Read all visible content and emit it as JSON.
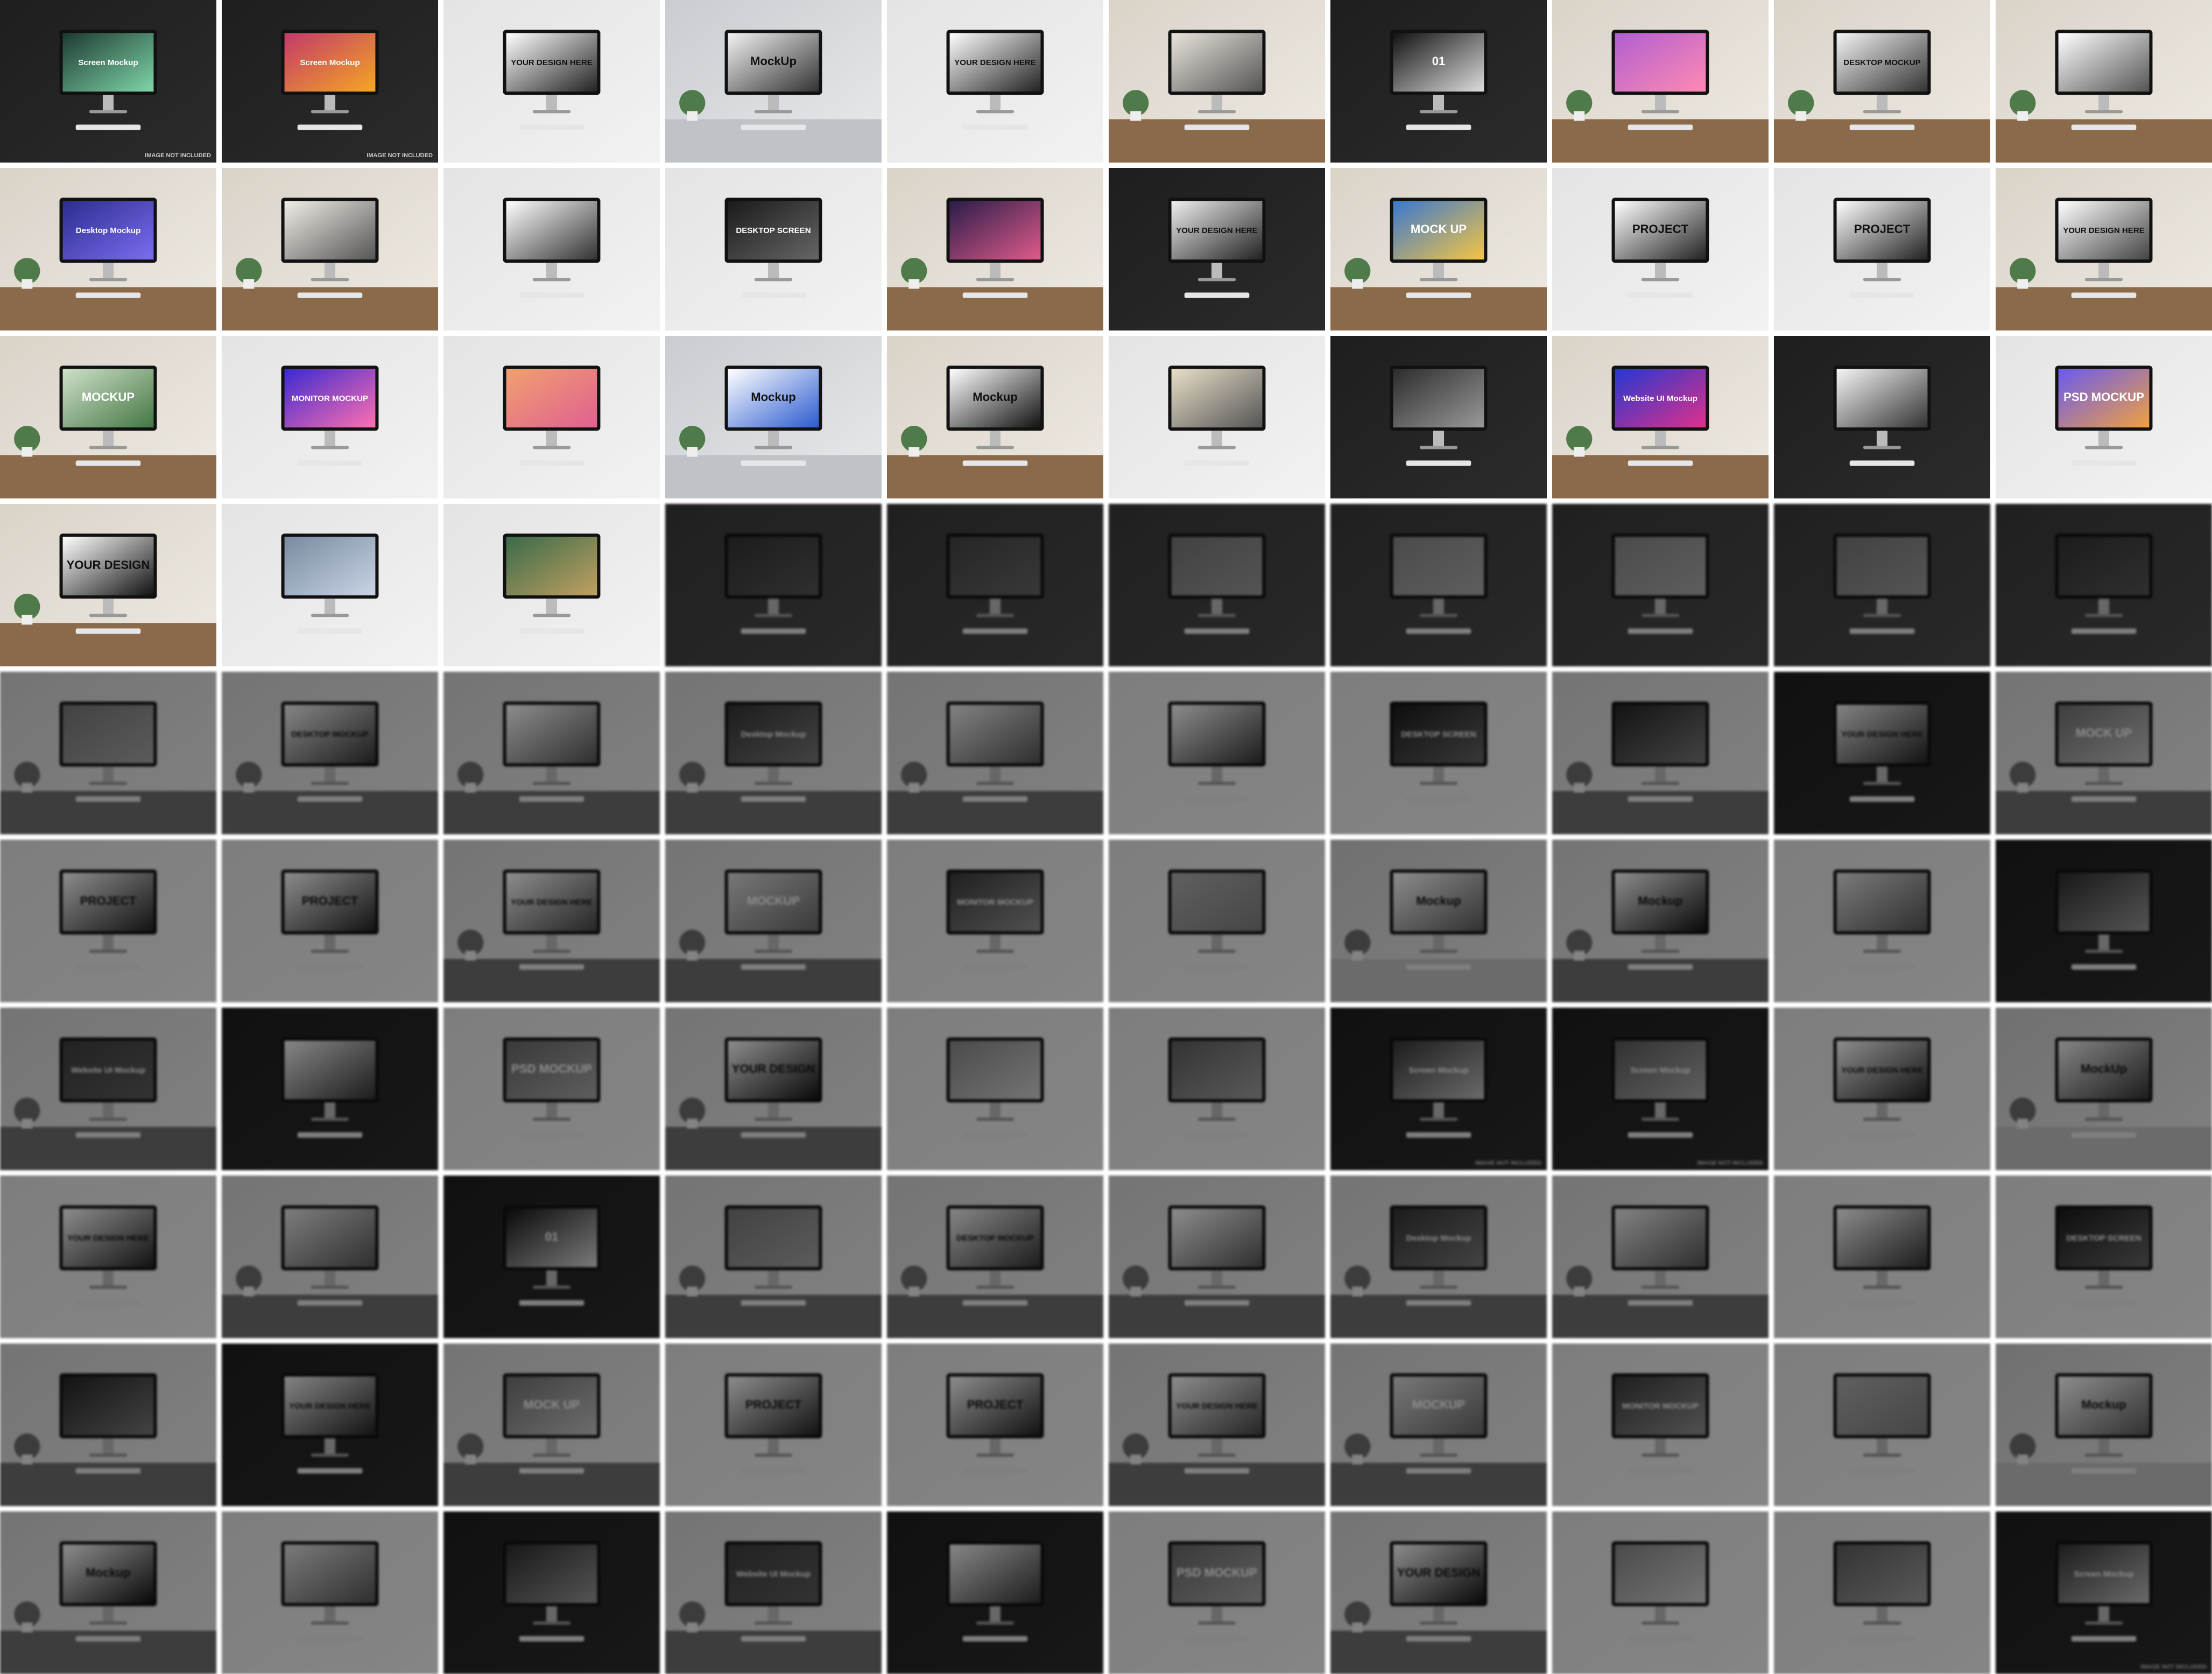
{
  "gallery": {
    "columns": 10,
    "rows": 10,
    "tiles": [
      {
        "style": "dark",
        "screen": "#1d3a32",
        "accent": "#7fd6a8",
        "text": "Screen Mockup",
        "caption": "IMAGE NOT INCLUDED"
      },
      {
        "style": "dark",
        "screen": "#c23a6a",
        "accent": "#f5a623",
        "text": "Screen Mockup",
        "caption": "IMAGE NOT INCLUDED"
      },
      {
        "style": "light",
        "screen": "#ffffff",
        "accent": "#222222",
        "text": "YOUR DESIGN HERE",
        "caption": ""
      },
      {
        "style": "photo",
        "screen": "#f2f2f2",
        "accent": "#333333",
        "text": "MockUp",
        "caption": ""
      },
      {
        "style": "light",
        "screen": "#ffffff",
        "accent": "#222222",
        "text": "YOUR DESIGN HERE",
        "caption": ""
      },
      {
        "style": "desk",
        "screen": "#e9e4dc",
        "accent": "#555555",
        "text": "",
        "caption": ""
      },
      {
        "style": "dark",
        "screen": "#111111",
        "accent": "#dddddd",
        "text": "01",
        "caption": ""
      },
      {
        "style": "desk",
        "screen": "#b05fd0",
        "accent": "#ff8ab3",
        "text": "",
        "caption": ""
      },
      {
        "style": "desk",
        "screen": "#f4f4f4",
        "accent": "#333333",
        "text": "DESKTOP MOCKUP",
        "caption": ""
      },
      {
        "style": "desk",
        "screen": "#ffffff",
        "accent": "#555555",
        "text": "",
        "caption": ""
      },
      {
        "style": "desk",
        "screen": "#2c2d8f",
        "accent": "#7b6df0",
        "text": "Desktop Mockup",
        "caption": ""
      },
      {
        "style": "desk",
        "screen": "#f1ede6",
        "accent": "#555555",
        "text": "",
        "caption": ""
      },
      {
        "style": "light",
        "screen": "#ffffff",
        "accent": "#333333",
        "text": "",
        "caption": ""
      },
      {
        "style": "light",
        "screen": "#1a1a1a",
        "accent": "#666666",
        "text": "DESKTOP SCREEN",
        "caption": ""
      },
      {
        "style": "desk",
        "screen": "#2a1d4a",
        "accent": "#e05a8a",
        "text": "",
        "caption": ""
      },
      {
        "style": "dark",
        "screen": "#eeeeee",
        "accent": "#222222",
        "text": "YOUR DESIGN HERE",
        "caption": ""
      },
      {
        "style": "desk",
        "screen": "#3a78d0",
        "accent": "#f5c542",
        "text": "MOCK UP",
        "caption": ""
      },
      {
        "style": "light",
        "screen": "#ffffff",
        "accent": "#222222",
        "text": "PROJECT",
        "caption": ""
      },
      {
        "style": "light",
        "screen": "#ffffff",
        "accent": "#222222",
        "text": "PROJECT",
        "caption": ""
      },
      {
        "style": "desk",
        "screen": "#ffffff",
        "accent": "#444444",
        "text": "YOUR DESIGN HERE",
        "caption": ""
      },
      {
        "style": "desk",
        "screen": "#cfe0c9",
        "accent": "#447744",
        "text": "MOCKUP",
        "caption": ""
      },
      {
        "style": "light",
        "screen": "#3a2ad0",
        "accent": "#ff6fb0",
        "text": "MONITOR MOCKUP",
        "caption": ""
      },
      {
        "style": "light",
        "screen": "#f0a070",
        "accent": "#e06090",
        "text": "",
        "caption": ""
      },
      {
        "style": "photo",
        "screen": "#ffffff",
        "accent": "#2b5bd0",
        "text": "Mockup",
        "caption": ""
      },
      {
        "style": "desk",
        "screen": "#ffffff",
        "accent": "#111111",
        "text": "Mockup",
        "caption": ""
      },
      {
        "style": "light",
        "screen": "#e8dfc8",
        "accent": "#555555",
        "text": "",
        "caption": ""
      },
      {
        "style": "dark",
        "screen": "#2c2c2c",
        "accent": "#999999",
        "text": "",
        "caption": ""
      },
      {
        "style": "desk",
        "screen": "#2438d0",
        "accent": "#e0308a",
        "text": "Website UI Mockup",
        "caption": ""
      },
      {
        "style": "dark",
        "screen": "#f5f5f5",
        "accent": "#333333",
        "text": "",
        "caption": ""
      },
      {
        "style": "light",
        "screen": "#6a5af0",
        "accent": "#f0a040",
        "text": "PSD MOCKUP",
        "caption": ""
      },
      {
        "style": "desk",
        "screen": "#ffffff",
        "accent": "#111111",
        "text": "YOUR DESIGN",
        "caption": ""
      },
      {
        "style": "light",
        "screen": "#7a8aa0",
        "accent": "#c8d4e6",
        "text": "",
        "caption": ""
      },
      {
        "style": "light",
        "screen": "#3a6a4a",
        "accent": "#c0a060",
        "text": "",
        "caption": ""
      },
      {
        "style": "dim",
        "screen": "#333333",
        "accent": "#555555",
        "text": "",
        "caption": ""
      },
      {
        "style": "dim",
        "screen": "#444444",
        "accent": "#666666",
        "text": "",
        "caption": ""
      },
      {
        "style": "dim",
        "screen": "#777777",
        "accent": "#999999",
        "text": "",
        "caption": ""
      },
      {
        "style": "dim",
        "screen": "#888888",
        "accent": "#aaaaaa",
        "text": "",
        "caption": ""
      },
      {
        "style": "dim",
        "screen": "#888888",
        "accent": "#aaaaaa",
        "text": "",
        "caption": ""
      },
      {
        "style": "dim",
        "screen": "#777777",
        "accent": "#999999",
        "text": "",
        "caption": ""
      },
      {
        "style": "dim",
        "screen": "#333333",
        "accent": "#555555",
        "text": "",
        "caption": ""
      }
    ]
  }
}
